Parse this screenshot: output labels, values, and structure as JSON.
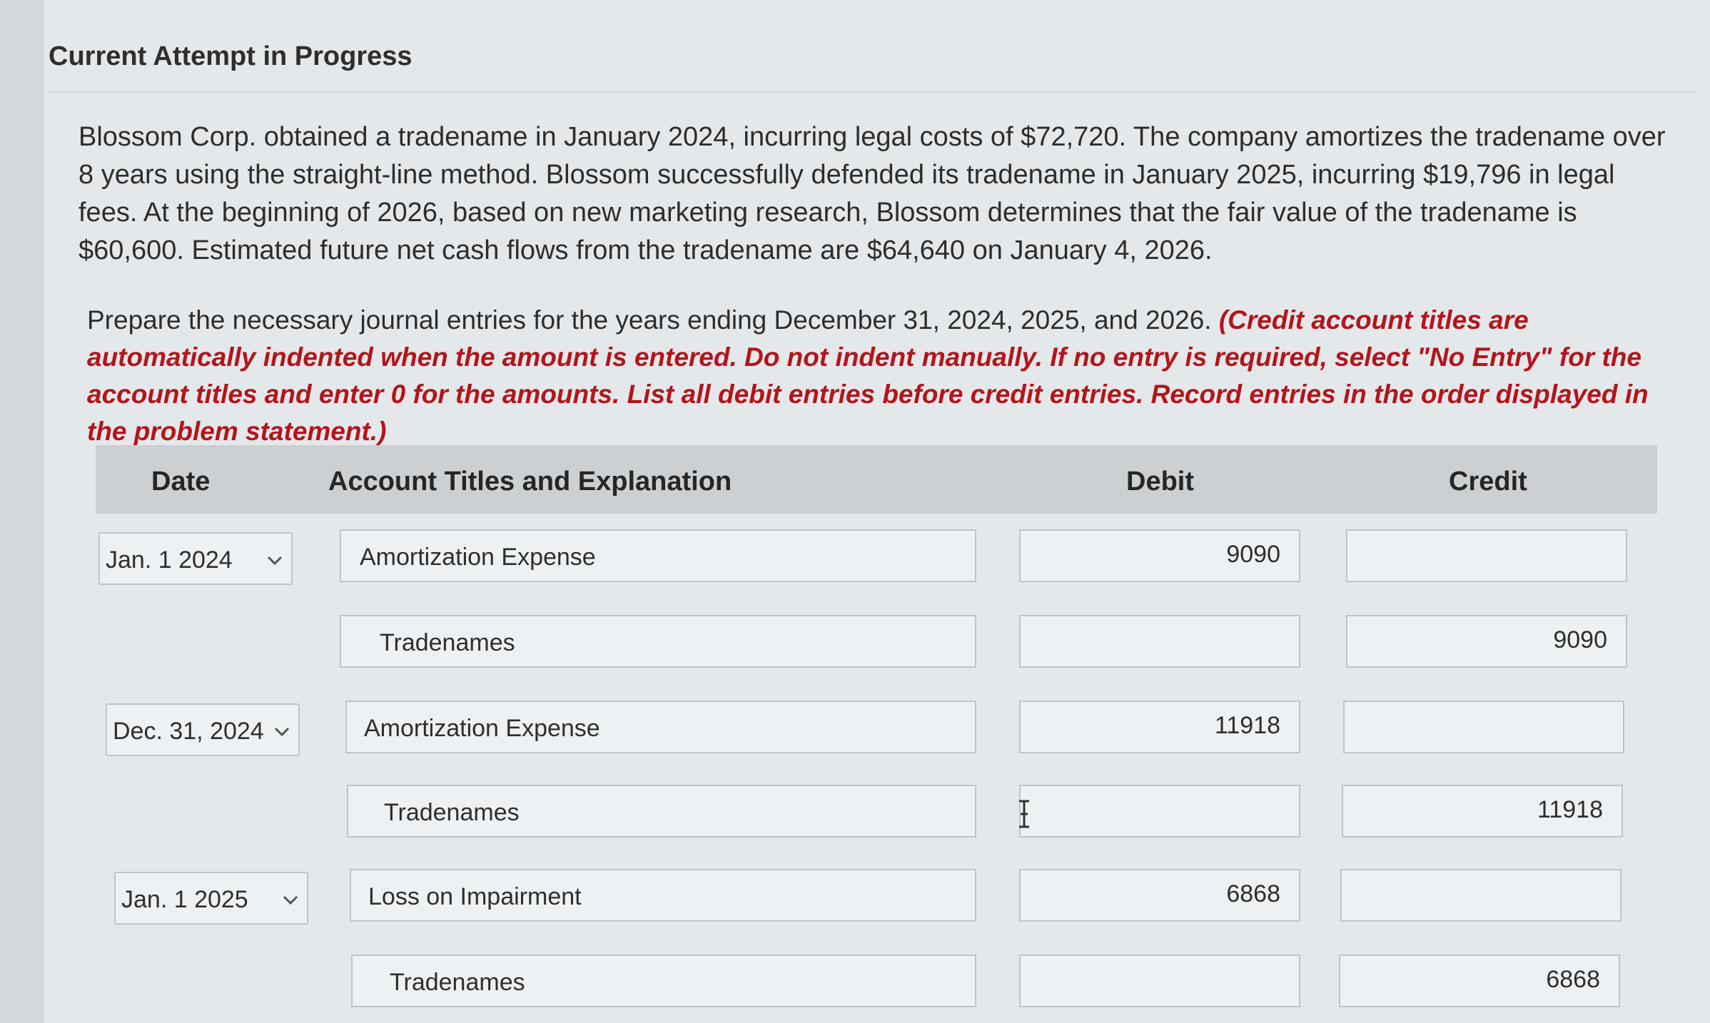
{
  "header": {
    "title": "Current Attempt in Progress"
  },
  "problem": {
    "text": "Blossom Corp. obtained a tradename in January 2024, incurring legal costs of $72,720. The company amortizes the tradename over 8 years using the straight-line method. Blossom successfully defended its tradename in January 2025, incurring $19,796 in legal fees. At the beginning of 2026, based on new marketing research, Blossom determines that the fair value of the tradename is $60,600. Estimated future net cash flows from the tradename are $64,640 on January 4, 2026."
  },
  "instructions": {
    "lead": "Prepare the necessary journal entries for the years ending December 31, 2024, 2025, and 2026.",
    "emphasis": "(Credit account titles are automatically indented when the amount is entered. Do not indent manually. If no entry is required, select \"No Entry\" for the account titles and enter 0 for the amounts. List all debit entries before credit entries. Record entries in the order displayed in the problem statement.)"
  },
  "table": {
    "headers": {
      "date": "Date",
      "account": "Account Titles and Explanation",
      "debit": "Debit",
      "credit": "Credit"
    },
    "rows": [
      {
        "date": "Jan. 1 2024",
        "account": "Amortization Expense",
        "debit": "9090",
        "credit": ""
      },
      {
        "date": "",
        "account": "Tradenames",
        "debit": "",
        "credit": "9090"
      },
      {
        "date": "Dec. 31, 2024",
        "account": "Amortization Expense",
        "debit": "11918",
        "credit": ""
      },
      {
        "date": "",
        "account": "Tradenames",
        "debit": "",
        "credit": "11918"
      },
      {
        "date": "Jan. 1 2025",
        "account": "Loss on Impairment",
        "debit": "6868",
        "credit": ""
      },
      {
        "date": "",
        "account": "Tradenames",
        "debit": "",
        "credit": "6868"
      }
    ]
  }
}
